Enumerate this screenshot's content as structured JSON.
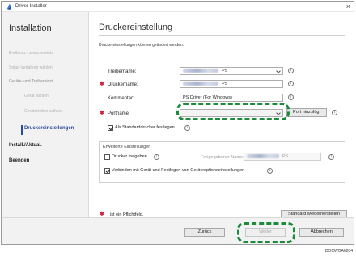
{
  "window": {
    "title": "Driver Installer",
    "close_glyph": "×"
  },
  "sidebar": {
    "title": "Installation",
    "items": [
      {
        "label": "Endbenu.-Lizenzvereinb."
      },
      {
        "label": "Setup-Verfahren wählen"
      },
      {
        "label": "Geräte- und Treibereinst."
      },
      {
        "label": "Gerät wählen"
      },
      {
        "label": "Gerätetreiber wählen"
      },
      {
        "label": "Druckereinstellungen"
      },
      {
        "label": "Install./Aktual."
      },
      {
        "label": "Beenden"
      }
    ]
  },
  "main": {
    "title": "Druckereinstellung",
    "description": "Druckereinstellungen können geändert werden.",
    "fields": {
      "driver_label": "Treibername:",
      "driver_value": "PS",
      "printer_label": "Druckername:",
      "printer_value": "PS",
      "comment_label": "Kommentar:",
      "comment_value": "PS Driver (For Windows)",
      "port_label": "Portname:",
      "port_value": ""
    },
    "add_port_button": "Port hinzufüg.",
    "default_printer_label": "Als Standarddrucker festlegen",
    "default_printer_checked": true,
    "advanced": {
      "title": "Erweiterte Einstellungen",
      "share_label": "Drucker freigeben",
      "share_checked": false,
      "share_name_label": "Freigegebener Name:",
      "share_name_value": "PS",
      "connect_label": "Verbinden mit Gerät und Festlegen von Geräteoptionseinstellungen",
      "connect_checked": true
    },
    "required_marker": "✱",
    "required_note": ": ist ein Pflichtfeld.",
    "restore_default_button": "Standard wiederherstellen",
    "info_glyph": "i"
  },
  "footer": {
    "back_button": "Zurück",
    "next_button": "Weiter",
    "cancel_button": "Abbrechen"
  },
  "doc_reference": "DOCWOA6204",
  "colors": {
    "highlight": "#1b8a3b",
    "required": "#d0203a",
    "accent": "#2c4a9a"
  }
}
